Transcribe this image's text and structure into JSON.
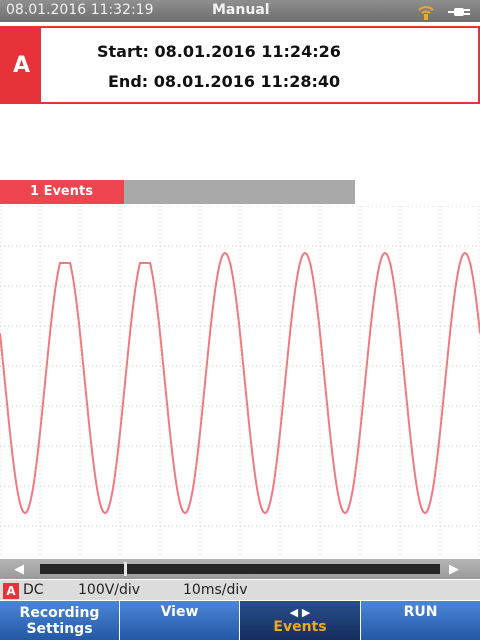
{
  "status_bar": {
    "datetime": "08.01.2016 11:32:19",
    "mode": "Manual",
    "icons": [
      "wifi-icon",
      "power-plug-icon"
    ]
  },
  "info_box": {
    "channel": "A",
    "start": "Start: 08.01.2016 11:24:26",
    "end": "End: 08.01.2016 11:28:40"
  },
  "events": {
    "label": "1 Events"
  },
  "scroll": {
    "left_arrow": "◀",
    "right_arrow": "▶",
    "position": 0.21
  },
  "channel_settings": {
    "channel": "A",
    "coupling": "DC",
    "volts_per_div": "100V/div",
    "time_per_div": "10ms/div"
  },
  "softkeys": {
    "recording_settings_line1": "Recording",
    "recording_settings_line2": "Settings",
    "view": "View",
    "events_arrows": "◀ ▶",
    "events": "Events",
    "run": "RUN"
  },
  "colors": {
    "accent_red": "#e8323a",
    "waveform": "#f07a80",
    "softkey_blue": "#2f6cc0",
    "softkey_active": "#1b3a70",
    "events_text": "#f0a81c"
  }
}
